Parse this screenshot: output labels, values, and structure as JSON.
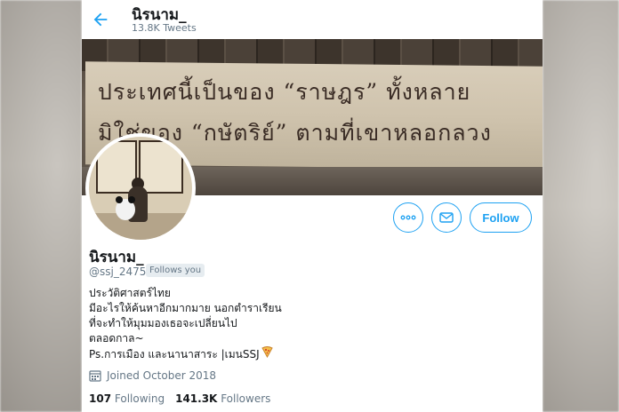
{
  "header": {
    "title": "นิรนาม_",
    "tweet_count": "13.8K Tweets"
  },
  "banner": {
    "line1": "ประเทศนี้เป็นของ “ราษฎร” ทั้งหลาย",
    "line2": "มิใช่ของ “กษัตริย์” ตามที่เขาหลอกลวง"
  },
  "profile": {
    "name": "นิรนาม_",
    "handle": "@ssj_2475",
    "follows_you": "Follows you",
    "bio_lines": [
      "ประวัติศาสตร์ไทย",
      "มีอะไรให้ค้นหาอีกมากมาย นอกตำราเรียน",
      "ที่จะทำให้มุมมองเธอจะเปลี่ยนไป",
      "ตลอดกาล~",
      "Ps.การเมือง และนานาสาระ |เมนSSJ"
    ],
    "joined": "Joined October 2018",
    "following_count": "107",
    "following_label": "Following",
    "followers_count": "141.3K",
    "followers_label": "Followers"
  },
  "buttons": {
    "follow": "Follow"
  },
  "icons": {
    "back": "arrow-left-icon",
    "more": "more-dots-icon",
    "message": "envelope-icon",
    "calendar": "calendar-icon",
    "pizza": "pizza-icon"
  },
  "colors": {
    "accent": "#1da1f2",
    "secondary_text": "#657786"
  }
}
